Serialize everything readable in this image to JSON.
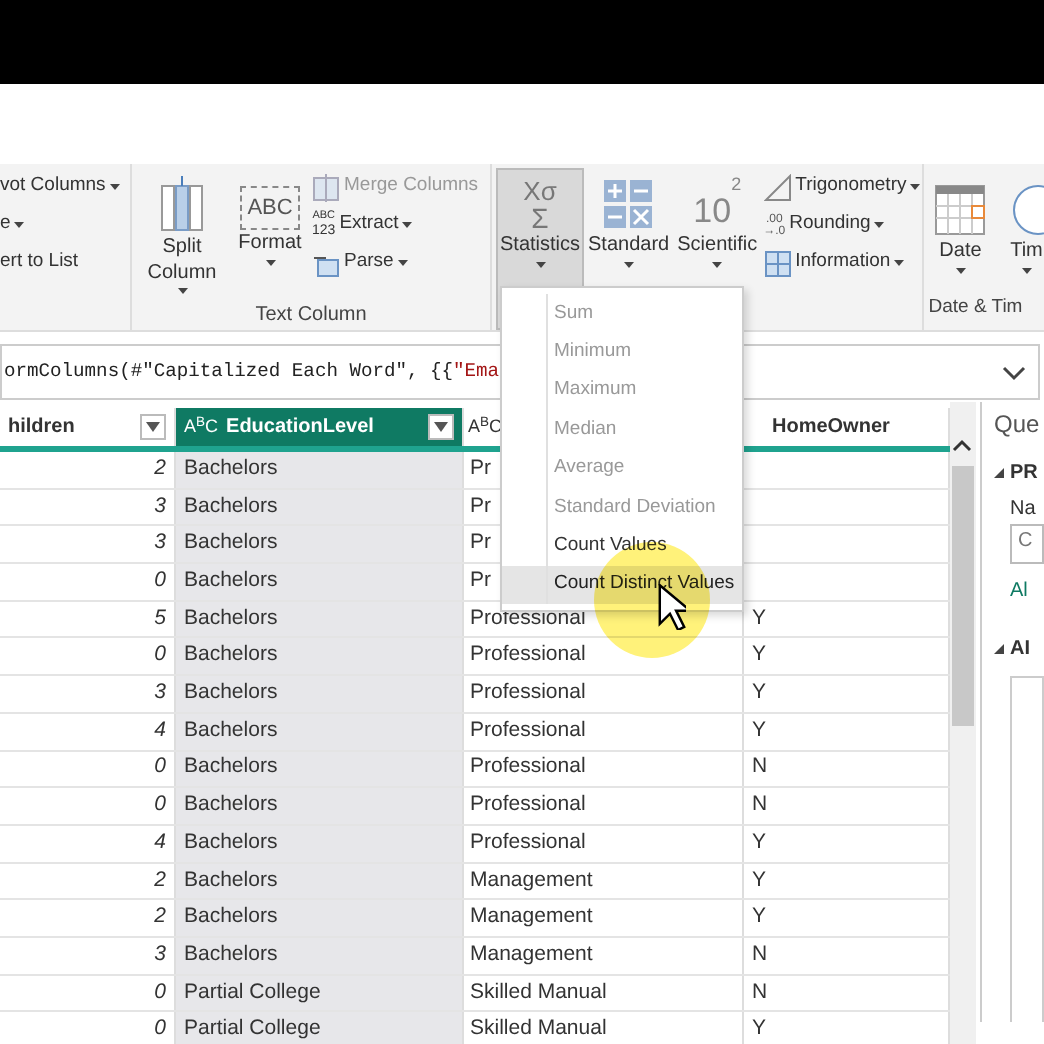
{
  "ribbon": {
    "partial_group": {
      "items": [
        {
          "label": "vot Columns",
          "dropdown": true
        },
        {
          "label": "e",
          "dropdown": true
        },
        {
          "label": "ert to List",
          "dropdown": false
        }
      ]
    },
    "text_column": {
      "label": "Text Column",
      "large": [
        {
          "label": "Split Column",
          "dropdown": true
        },
        {
          "label": "Format",
          "dropdown": true,
          "icon_text": "ABC"
        }
      ],
      "small": [
        {
          "label": "Merge Columns",
          "dropdown": false,
          "disabled": true
        },
        {
          "label": "Extract",
          "dropdown": true,
          "disabled": false,
          "icon_text": [
            "ABC",
            "123"
          ]
        },
        {
          "label": "Parse",
          "dropdown": true,
          "disabled": false
        }
      ]
    },
    "number_column": {
      "large": [
        {
          "label": "Statistics",
          "pressed": true,
          "icon_text": [
            "Xσ",
            "Σ"
          ]
        },
        {
          "label": "Standard",
          "pressed": false
        },
        {
          "label": "Scientific",
          "pressed": false,
          "icon_text": [
            "10",
            "2"
          ]
        }
      ],
      "small": [
        {
          "label": "Trigonometry"
        },
        {
          "label": "Rounding",
          "icon_text": [
            ".00",
            "→.0"
          ]
        },
        {
          "label": "Information"
        }
      ]
    },
    "date_time": {
      "label": "Date & Tim",
      "large": [
        {
          "label": "Date"
        },
        {
          "label": "Tim"
        }
      ]
    }
  },
  "statistics_menu": [
    {
      "label": "Sum",
      "disabled": true,
      "selected": false
    },
    {
      "label": "Minimum",
      "disabled": true,
      "selected": false
    },
    {
      "label": "Maximum",
      "disabled": true,
      "selected": false
    },
    {
      "label": "Median",
      "disabled": true,
      "selected": false
    },
    {
      "label": "Average",
      "disabled": true,
      "selected": false
    },
    {
      "label": "Standard Deviation",
      "disabled": true,
      "selected": false
    },
    {
      "label": "Count Values",
      "disabled": false,
      "selected": false
    },
    {
      "label": "Count Distinct Values",
      "disabled": false,
      "selected": true
    }
  ],
  "formula_bar": [
    {
      "text": "ormColumns(#\"Capitalized Each Word\", {{",
      "kind": "code"
    },
    {
      "text": "\"Ema",
      "kind": "string"
    }
  ],
  "table": {
    "columns": [
      {
        "label": "hildren",
        "selected": false,
        "filter": true
      },
      {
        "label": "EducationLevel",
        "selected": true,
        "type_icon": "A$^{B}$C",
        "filter": true
      },
      {
        "selected": false,
        "type_icon": "A$^{B}$C"
      },
      {
        "label": "HomeOwner",
        "selected": false,
        "filter": false
      }
    ],
    "rows": [
      [
        "2",
        "Bachelors",
        "Pr",
        ""
      ],
      [
        "3",
        "Bachelors",
        "Pr",
        ""
      ],
      [
        "3",
        "Bachelors",
        "Pr",
        ""
      ],
      [
        "0",
        "Bachelors",
        "Pr",
        ""
      ],
      [
        "5",
        "Bachelors",
        "Professional",
        "Y"
      ],
      [
        "0",
        "Bachelors",
        "Professional",
        "Y"
      ],
      [
        "3",
        "Bachelors",
        "Professional",
        "Y"
      ],
      [
        "4",
        "Bachelors",
        "Professional",
        "Y"
      ],
      [
        "0",
        "Bachelors",
        "Professional",
        "N"
      ],
      [
        "0",
        "Bachelors",
        "Professional",
        "N"
      ],
      [
        "4",
        "Bachelors",
        "Professional",
        "Y"
      ],
      [
        "2",
        "Bachelors",
        "Management",
        "Y"
      ],
      [
        "2",
        "Bachelors",
        "Management",
        "Y"
      ],
      [
        "3",
        "Bachelors",
        "Management",
        "N"
      ],
      [
        "0",
        "Partial College",
        "Skilled Manual",
        "N"
      ],
      [
        "0",
        "Partial College",
        "Skilled Manual",
        "Y"
      ]
    ]
  },
  "query_settings": {
    "title": "Que",
    "properties": "PR",
    "name_label": "Na",
    "name_value": "C",
    "link": "Al",
    "applied_steps": "AI"
  }
}
